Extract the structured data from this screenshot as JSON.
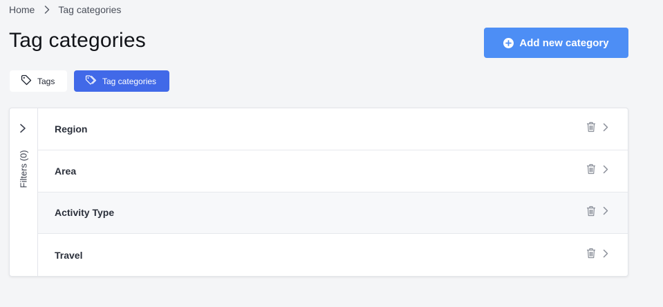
{
  "breadcrumb": {
    "home": "Home",
    "current": "Tag categories"
  },
  "page": {
    "title": "Tag categories"
  },
  "add_button": {
    "label": "Add new category"
  },
  "tabs": [
    {
      "label": "Tags",
      "active": false
    },
    {
      "label": "Tag categories",
      "active": true
    }
  ],
  "filters": {
    "label": "Filters  (0)",
    "count": 0
  },
  "categories": [
    {
      "name": "Region"
    },
    {
      "name": "Area"
    },
    {
      "name": "Activity Type"
    },
    {
      "name": "Travel"
    }
  ],
  "colors": {
    "primary_button": "#4d8ef5",
    "active_tab": "#4169e8",
    "background": "#f4f5f7"
  },
  "icons": [
    "chevron-right-icon",
    "plus-circle-icon",
    "tag-icon",
    "trash-icon"
  ]
}
